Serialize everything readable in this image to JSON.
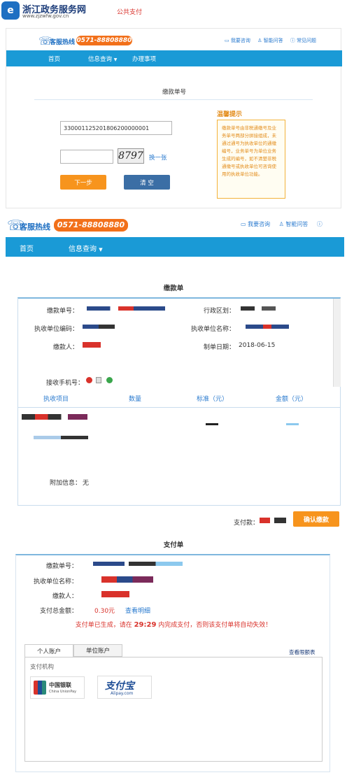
{
  "site": {
    "logo_glyph": "e",
    "name": "浙江政务服务网",
    "url": "www.zjzwfw.gov.cn",
    "page_title": "公共支付"
  },
  "header": {
    "hotline_label": "客服热线",
    "hotline_number": "0571-88808880",
    "links": [
      "我要咨询",
      "智能问答",
      "常见问题"
    ]
  },
  "nav": {
    "items": [
      "首页",
      "信息查询",
      "办理事项"
    ],
    "dropdown_glyph": "▼"
  },
  "query_form": {
    "title": "缴款单号",
    "order_value": "330001125201806200000001",
    "captcha_value": "",
    "captcha_image_text": "8797",
    "refresh_label": "换一张",
    "next_label": "下一步",
    "clear_label": "清 空",
    "tip_title": "温馨提示",
    "tip_text": "缴款单号由非税通缴号及业务单号两部分拼接组成，未通过通号为执收单位的通缴编号，业务单号为单位业务生成的编号，如不清楚非税通缴号或执收单位可咨询使用的执收单位功能。"
  },
  "payment_notice": {
    "title": "缴款单",
    "labels": {
      "order_no": "缴款单号：",
      "region": "行政区划：",
      "unit_code": "执收单位编码：",
      "unit_name": "执收单位名称：",
      "payer": "缴款人：",
      "date": "制单日期：",
      "phone": "接收手机号：",
      "extra": "附加信息："
    },
    "date_value": "2018-06-15",
    "extra_value": "无",
    "columns": [
      "执收项目",
      "数量",
      "标准（元）",
      "金额（元）"
    ],
    "pay_label": "支付款：",
    "confirm_label": "确认缴款"
  },
  "payment_sheet": {
    "title": "支付单",
    "labels": {
      "order_no": "缴款单号：",
      "unit_name": "执收单位名称：",
      "payer": "缴款人：",
      "total": "支付总金额："
    },
    "total_value": "0.30元",
    "detail_link": "查看明细",
    "countdown_prefix": "支付单已生成，请在",
    "countdown_time": "29:29",
    "countdown_suffix": "内完成支付，否则该支付单将自动失效！",
    "tabs": [
      "个人账户",
      "单位账户"
    ],
    "limit_link": "查看限额表",
    "institution_label": "支付机构",
    "unionpay_cn": "中国银联",
    "unionpay_en": "China UnionPay",
    "alipay_cn": "支付宝",
    "alipay_en": "Alipay.com"
  },
  "colors": {
    "nav_blue": "#1a9ad6",
    "orange": "#f7941d",
    "accent_red": "#d9322b",
    "link_blue": "#2b7bcf"
  }
}
